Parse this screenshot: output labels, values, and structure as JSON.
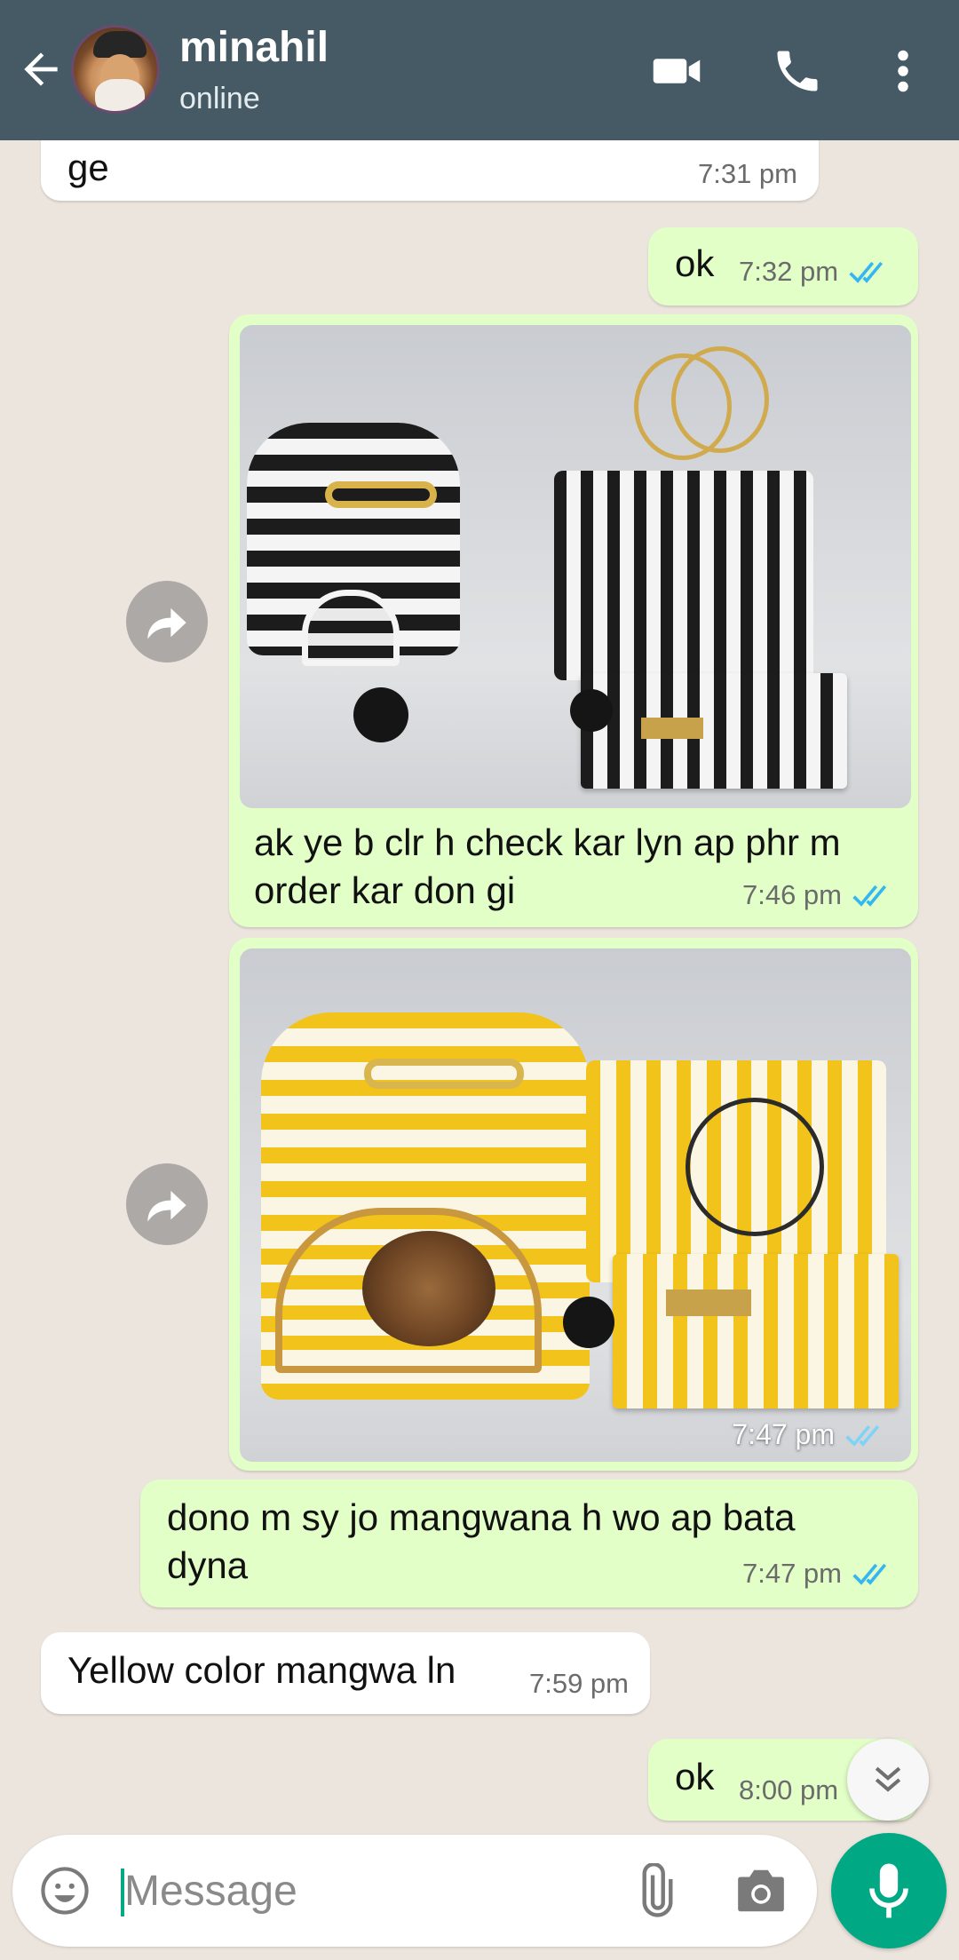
{
  "header": {
    "contact_name": "minahil",
    "status": "online",
    "bg_color": "#455a64"
  },
  "messages": [
    {
      "direction": "incoming",
      "text": "ge",
      "time": "7:31 pm"
    },
    {
      "direction": "outgoing",
      "text": "ok",
      "time": "7:32 pm",
      "read": true
    },
    {
      "direction": "outgoing",
      "type": "image",
      "image": "black-white-striped-bag-set",
      "caption": "ak ye b clr h check kar lyn ap phr m order kar don gi",
      "time": "7:46 pm",
      "read": true
    },
    {
      "direction": "outgoing",
      "type": "image",
      "image": "yellow-white-striped-bag-set",
      "time": "7:47 pm",
      "read": true
    },
    {
      "direction": "outgoing",
      "text": "dono m sy jo mangwana h wo ap bata dyna",
      "time": "7:47 pm",
      "read": true
    },
    {
      "direction": "incoming",
      "text": "Yellow color mangwa ln",
      "time": "7:59 pm"
    },
    {
      "direction": "outgoing",
      "text": "ok",
      "time": "8:00 pm",
      "read": true
    }
  ],
  "caption_lines": [
    "ak ye b clr h check kar lyn ap phr m",
    "order kar don gi"
  ],
  "msg5_lines": [
    "dono m sy jo mangwana h wo ap bata",
    "dyna"
  ],
  "composer": {
    "placeholder": "Message"
  },
  "colors": {
    "outgoing_bubble": "#e2ffc7",
    "incoming_bubble": "#ffffff",
    "read_ticks": "#34b7f1",
    "accent": "#00a884"
  }
}
